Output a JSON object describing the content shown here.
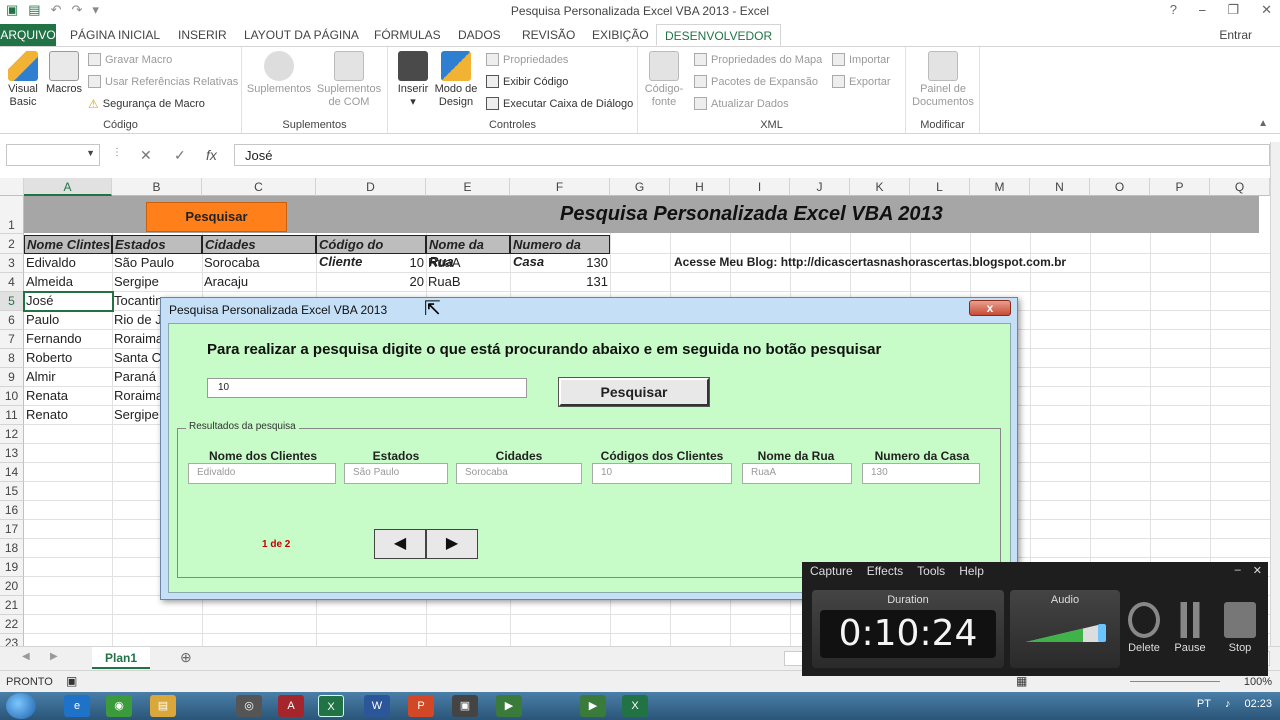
{
  "window": {
    "title": "Pesquisa Personalizada Excel VBA 2013 - Excel",
    "controls": [
      "?",
      "⎯",
      "❐",
      "✕"
    ]
  },
  "tabs": [
    {
      "label": "ARQUIVO"
    },
    {
      "label": "PÁGINA INICIAL"
    },
    {
      "label": "INSERIR"
    },
    {
      "label": "LAYOUT DA PÁGINA"
    },
    {
      "label": "FÓRMULAS"
    },
    {
      "label": "DADOS"
    },
    {
      "label": "REVISÃO"
    },
    {
      "label": "EXIBIÇÃO"
    },
    {
      "label": "DESENVOLVEDOR"
    }
  ],
  "signin": "Entrar",
  "ribbon": {
    "codigo": {
      "label": "Código",
      "visual_basic": "Visual Basic",
      "macros": "Macros",
      "gravar_macro": "Gravar Macro",
      "referencias": "Usar Referências Relativas",
      "seguranca": "Segurança de Macro"
    },
    "suplementos": {
      "label": "Suplementos",
      "suplementos": "Suplementos",
      "com": "Suplementos de COM"
    },
    "controles": {
      "label": "Controles",
      "inserir": "Inserir",
      "modo_design": "Modo de Design",
      "propriedades": "Propriedades",
      "exibir_codigo": "Exibir Código",
      "executar": "Executar Caixa de Diálogo"
    },
    "xml": {
      "label": "XML",
      "codigo_fonte": "Código-fonte",
      "prop_mapa": "Propriedades do Mapa",
      "pacotes": "Pacotes de Expansão",
      "atualizar": "Atualizar Dados",
      "importar": "Importar",
      "exportar": "Exportar"
    },
    "modificar": {
      "label": "Modificar",
      "painel": "Painel de Documentos"
    }
  },
  "formula_bar": {
    "name_box": "",
    "value": "José"
  },
  "sheet": {
    "columns": [
      "A",
      "B",
      "C",
      "D",
      "E",
      "F",
      "G",
      "H",
      "I",
      "J",
      "K",
      "L",
      "M",
      "N",
      "O",
      "P",
      "Q"
    ],
    "rows": [
      "1",
      "2",
      "3",
      "4",
      "5",
      "6",
      "7",
      "8",
      "9",
      "10",
      "11",
      "12",
      "13",
      "14",
      "15",
      "16",
      "17",
      "18",
      "19",
      "20",
      "21",
      "22",
      "23"
    ],
    "title": "Pesquisa Personalizada Excel VBA 2013",
    "button_label": "Pesquisar",
    "headers": [
      "Nome Clintes",
      "Estados",
      "Cidades",
      "Código do Cliente",
      "Nome da Rua",
      "Numero da Casa"
    ],
    "data": [
      [
        "Edivaldo",
        "São Paulo",
        "Sorocaba",
        "10",
        "RuaA",
        "130"
      ],
      [
        "Almeida",
        "Sergipe",
        "Aracaju",
        "20",
        "RuaB",
        "131"
      ],
      [
        "José",
        "Tocantins",
        "",
        "",
        "",
        ""
      ],
      [
        "Paulo",
        "Rio de J",
        "",
        "",
        "",
        ""
      ],
      [
        "Fernando",
        "Roraima",
        "",
        "",
        "",
        ""
      ],
      [
        "Roberto",
        "Santa Ca",
        "",
        "",
        "",
        ""
      ],
      [
        "Almir",
        "Paraná",
        "",
        "",
        "",
        ""
      ],
      [
        "Renata",
        "Roraima",
        "",
        "",
        "",
        ""
      ],
      [
        "Renato",
        "Sergipe",
        "",
        "",
        "",
        ""
      ]
    ],
    "blog": "Acesse Meu Blog: http://dicascertasnashorascertas.blogspot.com.br",
    "sheet_tab": "Plan1",
    "status": "PRONTO",
    "zoom": "100%"
  },
  "dialog": {
    "title": "Pesquisa Personalizada Excel VBA 2013",
    "close": "x",
    "heading": "Para realizar a pesquisa digite o que está procurando abaixo e em seguida no botão pesquisar",
    "search_value": "10",
    "search_button": "Pesquisar",
    "frame_label": "Resultados da pesquisa",
    "result_headers": [
      "Nome dos Clientes",
      "Estados",
      "Cidades",
      "Códigos dos Clientes",
      "Nome da Rua",
      "Numero da Casa"
    ],
    "result_values": [
      "Edivaldo",
      "São Paulo",
      "Sorocaba",
      "10",
      "RuaA",
      "130"
    ],
    "pager": "1 de 2",
    "prev": "◀",
    "next": "▶"
  },
  "recorder": {
    "menu": [
      "Capture",
      "Effects",
      "Tools",
      "Help"
    ],
    "duration_label": "Duration",
    "duration": "0:10:24",
    "audio_label": "Audio",
    "audio_level": 0.75,
    "delete": "Delete",
    "pause": "Pause",
    "stop": "Stop"
  },
  "taskbar": {
    "lang": "PT",
    "time": "02:23"
  },
  "colors": {
    "excel_green": "#217346",
    "orange_button": "#ff7f1a",
    "dialog_body": "#c7fbc7",
    "pager_red": "#c00000"
  }
}
